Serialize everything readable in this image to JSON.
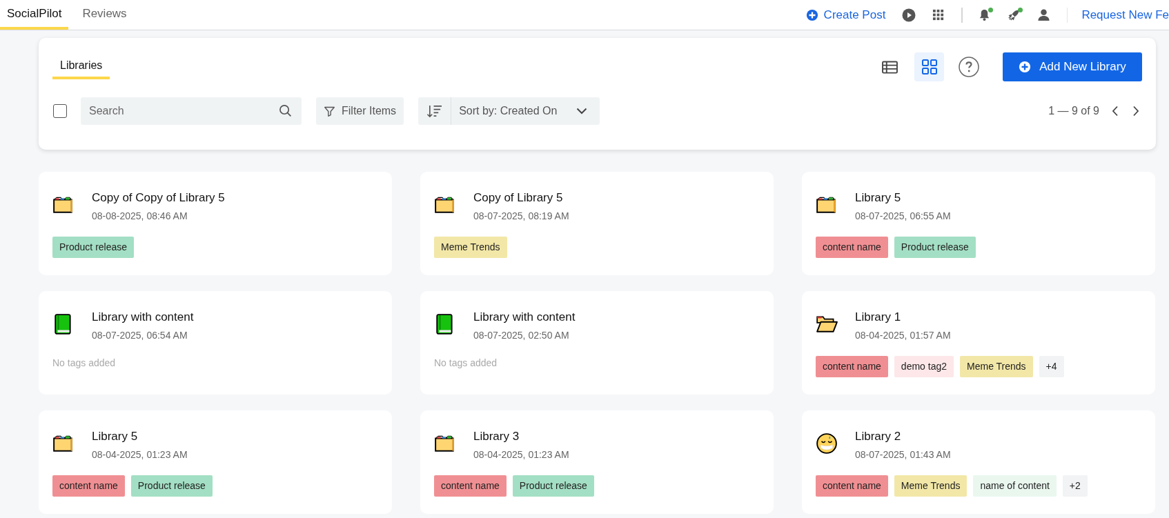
{
  "topbar": {
    "tabs": [
      {
        "label": "SocialPilot",
        "selected": true
      },
      {
        "label": "Reviews",
        "selected": false
      }
    ],
    "create_post": "Create Post",
    "notifications": {
      "bell_dot": true,
      "rocket_dot": true
    },
    "request_link": "Request New Fe"
  },
  "panel": {
    "tabs": [
      {
        "label": "Libraries",
        "selected": true
      }
    ],
    "views": [
      {
        "kind": "list",
        "selected": false
      },
      {
        "kind": "grid",
        "selected": true
      }
    ],
    "add_button": "Add New Library",
    "select_all": {
      "checked": false
    },
    "search": {
      "placeholder": "Search"
    },
    "filter": "Filter Items",
    "sort": "Sort by: Created On",
    "pagination": "1 — 9 of 9"
  },
  "libraries": [
    {
      "kind": "folder",
      "title": "Copy of Copy of Library 5",
      "date": "08-08-2025, 08:46 AM",
      "tags": [
        {
          "label": "Product release",
          "color": "#a3dfc4"
        }
      ]
    },
    {
      "kind": "folder",
      "title": "Copy of Library 5",
      "date": "08-07-2025, 08:19 AM",
      "tags": [
        {
          "label": "Meme Trends",
          "color": "#f2e7a7"
        }
      ]
    },
    {
      "kind": "folder",
      "title": "Library 5",
      "date": "08-07-2025, 06:55 AM",
      "tags": [
        {
          "label": "content name",
          "color": "#f08f93"
        },
        {
          "label": "Product release",
          "color": "#a3dfc4"
        }
      ]
    },
    {
      "kind": "book",
      "title": "Library with content",
      "date": "08-07-2025, 06:54 AM",
      "empty_text": "No tags added"
    },
    {
      "kind": "book",
      "title": "Library with content",
      "date": "08-07-2025, 02:50 AM",
      "empty_text": "No tags added"
    },
    {
      "kind": "open_folder",
      "title": "Library 1",
      "date": "08-04-2025, 01:57 AM",
      "tags": [
        {
          "label": "content name",
          "color": "#f08f93"
        },
        {
          "label": "demo tag2",
          "color": "#fde7e9"
        },
        {
          "label": "Meme Trends",
          "color": "#f2e7a7"
        },
        {
          "label": "+4",
          "color": "#f1f3f4"
        }
      ]
    },
    {
      "kind": "folder",
      "title": "Library 5",
      "date": "08-04-2025, 01:23 AM",
      "tags": [
        {
          "label": "content name",
          "color": "#f08f93"
        },
        {
          "label": "Product release",
          "color": "#a3dfc4"
        }
      ]
    },
    {
      "kind": "folder",
      "title": "Library 3",
      "date": "08-04-2025, 01:23 AM",
      "tags": [
        {
          "label": "content name",
          "color": "#f08f93"
        },
        {
          "label": "Product release",
          "color": "#a3dfc4"
        }
      ]
    },
    {
      "kind": "face",
      "title": "Library 2",
      "date": "08-07-2025, 01:43 AM",
      "tags": [
        {
          "label": "content name",
          "color": "#f08f93"
        },
        {
          "label": "Meme Trends",
          "color": "#f2e7a7"
        },
        {
          "label": "name of content",
          "color": "#eaf7ef"
        },
        {
          "label": "+2",
          "color": "#f1f3f4"
        }
      ]
    }
  ]
}
